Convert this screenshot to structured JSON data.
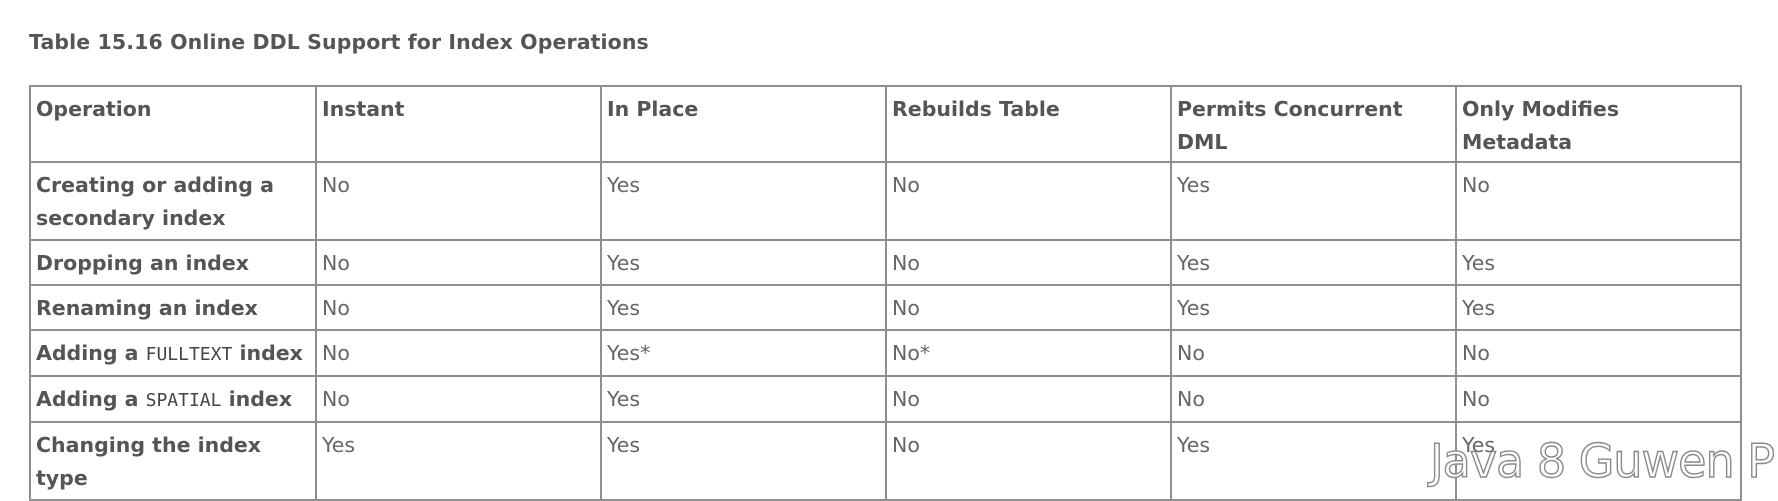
{
  "caption": "Table 15.16 Online DDL Support for Index Operations",
  "columns": [
    "Operation",
    "Instant",
    "In Place",
    "Rebuilds Table",
    "Permits Concurrent DML",
    "Only Modifies Metadata"
  ],
  "rows": [
    {
      "operation": {
        "prefix": "Creating or adding a secondary index",
        "code": "",
        "suffix": ""
      },
      "values": [
        "No",
        "Yes",
        "No",
        "Yes",
        "No"
      ]
    },
    {
      "operation": {
        "prefix": "Dropping an index",
        "code": "",
        "suffix": ""
      },
      "values": [
        "No",
        "Yes",
        "No",
        "Yes",
        "Yes"
      ]
    },
    {
      "operation": {
        "prefix": "Renaming an index",
        "code": "",
        "suffix": ""
      },
      "values": [
        "No",
        "Yes",
        "No",
        "Yes",
        "Yes"
      ]
    },
    {
      "operation": {
        "prefix": "Adding a ",
        "code": "FULLTEXT",
        "suffix": " index"
      },
      "values": [
        "No",
        "Yes*",
        "No*",
        "No",
        "No"
      ]
    },
    {
      "operation": {
        "prefix": "Adding a ",
        "code": "SPATIAL",
        "suffix": " index"
      },
      "values": [
        "No",
        "Yes",
        "No",
        "No",
        "No"
      ]
    },
    {
      "operation": {
        "prefix": "Changing the index type",
        "code": "",
        "suffix": ""
      },
      "values": [
        "Yes",
        "Yes",
        "No",
        "Yes",
        "Yes"
      ]
    }
  ],
  "watermark": "Java 8 Guwen P"
}
